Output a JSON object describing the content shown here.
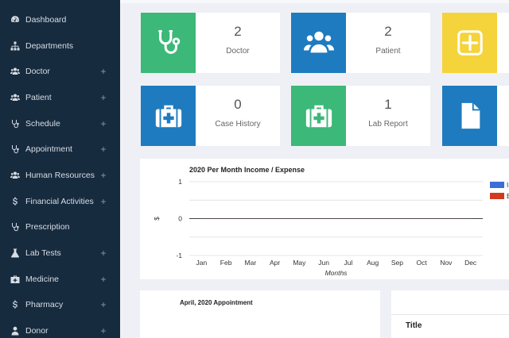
{
  "sidebar": {
    "items": [
      {
        "label": "Dashboard",
        "icon": "dashboard-icon",
        "expandable": false
      },
      {
        "label": "Departments",
        "icon": "sitemap-icon",
        "expandable": false
      },
      {
        "label": "Doctor",
        "icon": "users-icon",
        "expandable": true
      },
      {
        "label": "Patient",
        "icon": "users-icon",
        "expandable": true
      },
      {
        "label": "Schedule",
        "icon": "stethoscope-icon",
        "expandable": true
      },
      {
        "label": "Appointment",
        "icon": "stethoscope-icon",
        "expandable": true
      },
      {
        "label": "Human Resources",
        "icon": "users-icon",
        "expandable": true
      },
      {
        "label": "Financial Activities",
        "icon": "dollar-icon",
        "expandable": true
      },
      {
        "label": "Prescription",
        "icon": "stethoscope-icon",
        "expandable": false
      },
      {
        "label": "Lab Tests",
        "icon": "flask-icon",
        "expandable": true
      },
      {
        "label": "Medicine",
        "icon": "medkit-icon",
        "expandable": true
      },
      {
        "label": "Pharmacy",
        "icon": "dollar-icon",
        "expandable": true
      },
      {
        "label": "Donor",
        "icon": "user-icon",
        "expandable": true
      }
    ],
    "plus_symbol": "+"
  },
  "cards": [
    {
      "count": "2",
      "label": "Doctor",
      "icon": "stethoscope-icon",
      "color": "#3cb878"
    },
    {
      "count": "2",
      "label": "Patient",
      "icon": "users-icon",
      "color": "#1e7bbf"
    },
    {
      "count": "",
      "label": "",
      "icon": "plus-square-icon",
      "color": "#f5d33a"
    },
    {
      "count": "0",
      "label": "Case History",
      "icon": "medkit-icon",
      "color": "#1e7bbf"
    },
    {
      "count": "1",
      "label": "Lab Report",
      "icon": "medkit-icon",
      "color": "#3cb878"
    },
    {
      "count": "",
      "label": "",
      "icon": "file-icon",
      "color": "#1e7bbf"
    }
  ],
  "chart_data": {
    "type": "line",
    "title": "2020 Per Month Income / Expense",
    "xlabel": "Months",
    "ylabel": "$",
    "categories": [
      "Jan",
      "Feb",
      "Mar",
      "Apr",
      "May",
      "Jun",
      "Jul",
      "Aug",
      "Sep",
      "Oct",
      "Nov",
      "Dec"
    ],
    "y_ticks": [
      "1",
      "0",
      "-1"
    ],
    "ylim": [
      -1,
      1
    ],
    "series": [
      {
        "name": "In",
        "color": "#3b6fd6",
        "values": [
          0,
          0,
          0,
          0,
          0,
          0,
          0,
          0,
          0,
          0,
          0,
          0
        ]
      },
      {
        "name": "E",
        "color": "#d23a1f",
        "values": [
          0,
          0,
          0,
          0,
          0,
          0,
          0,
          0,
          0,
          0,
          0,
          0
        ]
      }
    ],
    "legend": "right"
  },
  "appointment_panel": {
    "title": "April, 2020 Appointment"
  },
  "side_panel": {
    "title": "Title"
  }
}
